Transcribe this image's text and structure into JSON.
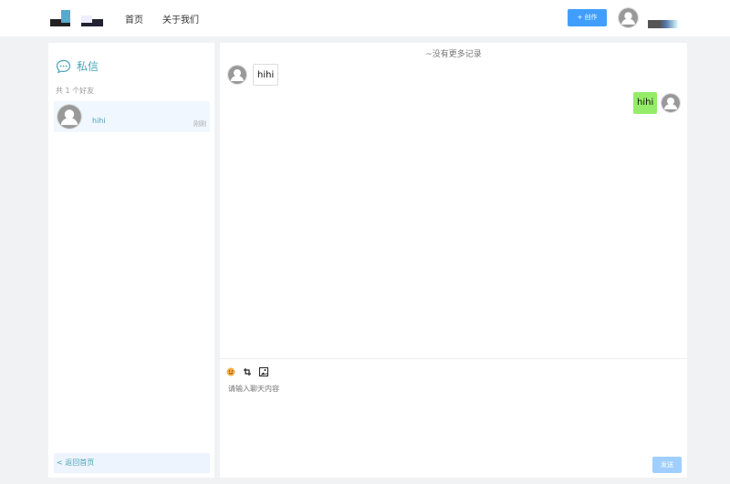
{
  "header": {
    "nav": [
      "首页",
      "关于我们"
    ],
    "create_label": "+ 创作"
  },
  "sidebar": {
    "title": "私信",
    "count_text": "共 1 个好友",
    "friends": [
      {
        "name": "hihi",
        "time": "刚刚"
      }
    ],
    "back_label": "< 返回首页"
  },
  "chat": {
    "no_more": "~没有更多记录",
    "messages": [
      {
        "from": "other",
        "text": "hihi"
      },
      {
        "from": "me",
        "text": "hihi"
      }
    ],
    "input_placeholder": "请输入聊天内容",
    "send_label": "发送"
  },
  "colors": {
    "accent": "#409eff",
    "teal": "#4aa3b8",
    "my_bubble": "#95ec69"
  }
}
